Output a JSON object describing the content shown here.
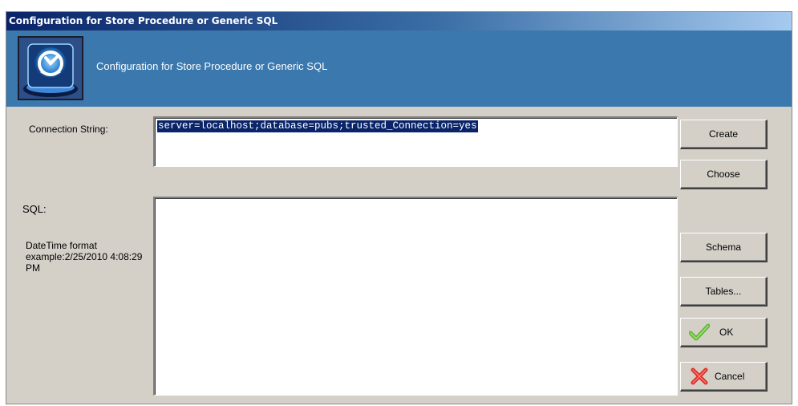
{
  "window": {
    "title": "Configuration for Store Procedure or Generic SQL"
  },
  "banner": {
    "text": "Configuration for Store Procedure or Generic SQL",
    "logo_icon": "server-connection-icon"
  },
  "form": {
    "connection_label": "Connection String:",
    "connection_value": "server=localhost;database=pubs;trusted_Connection=yes",
    "sql_label": "SQL:",
    "sql_value": "",
    "datetime_hint": "DateTime format example:2/25/2010 4:08:29 PM"
  },
  "buttons": {
    "create": "Create",
    "choose": "Choose",
    "schema": "Schema",
    "tables": "Tables...",
    "ok": "OK",
    "ok_icon": "checkmark-icon",
    "cancel": "Cancel",
    "cancel_icon": "x-icon"
  },
  "colors": {
    "banner": "#3b78ad",
    "dialog": "#d4d0c8",
    "selection": "#0a246a",
    "ok_check": "#5db833",
    "cancel_x": "#e0302a"
  }
}
